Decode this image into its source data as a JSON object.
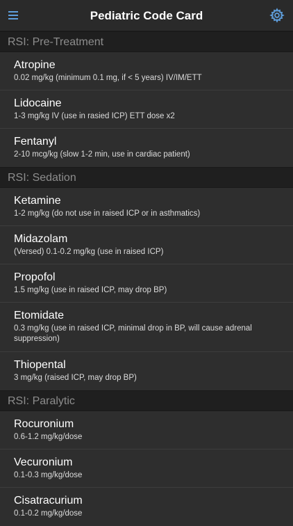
{
  "header": {
    "title": "Pediatric Code Card",
    "menu_icon": "menu-icon",
    "settings_icon": "gear-icon",
    "accent_color": "#5f9fdd"
  },
  "sections": [
    {
      "title": "RSI: Pre-Treatment",
      "items": [
        {
          "name": "Atropine",
          "dose": "0.02 mg/kg (minimum 0.1 mg, if < 5 years) IV/IM/ETT"
        },
        {
          "name": "Lidocaine",
          "dose": "1-3 mg/kg IV (use in rasied ICP) ETT dose x2"
        },
        {
          "name": "Fentanyl",
          "dose": "2-10 mcg/kg (slow 1-2 min, use in cardiac patient)"
        }
      ]
    },
    {
      "title": "RSI: Sedation",
      "items": [
        {
          "name": "Ketamine",
          "dose": "1-2 mg/kg (do not use in raised ICP or in asthmatics)"
        },
        {
          "name": "Midazolam",
          "dose": "(Versed) 0.1-0.2 mg/kg (use in raised ICP)"
        },
        {
          "name": "Propofol",
          "dose": "1.5 mg/kg (use in raised ICP, may drop BP)"
        },
        {
          "name": "Etomidate",
          "dose": "0.3 mg/kg (use in raised ICP, minimal drop in BP, will cause adrenal suppression)"
        },
        {
          "name": "Thiopental",
          "dose": "3 mg/kg (raised ICP, may drop BP)"
        }
      ]
    },
    {
      "title": "RSI: Paralytic",
      "items": [
        {
          "name": "Rocuronium",
          "dose": "0.6-1.2 mg/kg/dose"
        },
        {
          "name": "Vecuronium",
          "dose": "0.1-0.3 mg/kg/dose"
        },
        {
          "name": "Cisatracurium",
          "dose": "0.1-0.2 mg/kg/dose"
        }
      ]
    }
  ]
}
